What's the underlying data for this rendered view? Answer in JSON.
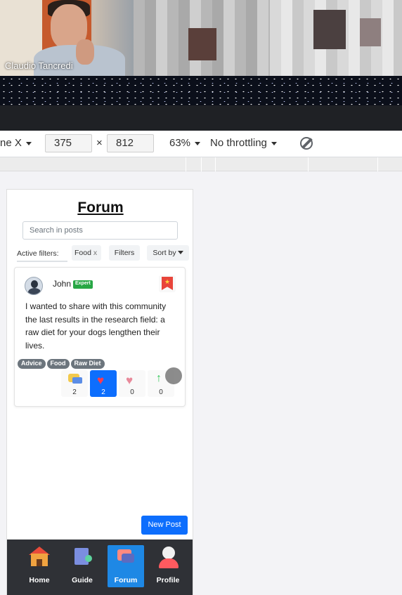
{
  "video_call": {
    "self_name": "Claudio Tancredi"
  },
  "devtools": {
    "device_label": "ne X",
    "width_value": "375",
    "times_symbol": "×",
    "height_value": "812",
    "zoom_label": "63%",
    "throttle_label": "No throttling"
  },
  "app": {
    "title": "Forum",
    "search": {
      "placeholder": "Search in posts"
    },
    "filters": {
      "active_label": "Active filters:",
      "chip_label": "Food",
      "chip_remove": "x",
      "filters_button": "Filters",
      "sort_button": "Sort by"
    },
    "post": {
      "author": "John",
      "badge": "Expert",
      "body": "I wanted to share with this community the last results in the research field: a raw diet for your dogs lengthen their lives.",
      "tags": [
        "Advice",
        "Food",
        "Raw Diet"
      ],
      "comments_count": "2",
      "likes_count": "2",
      "dislikes_count": "0",
      "shares_count": "0"
    },
    "new_post_button": "New Post",
    "nav": {
      "home": "Home",
      "guide": "Guide",
      "forum": "Forum",
      "profile": "Profile",
      "active": "forum"
    }
  },
  "colors": {
    "primary": "#0d6efd",
    "expert_badge": "#28a745",
    "tag": "#6c757d",
    "nav_background": "#2f3136",
    "nav_active": "#1e88e5"
  }
}
